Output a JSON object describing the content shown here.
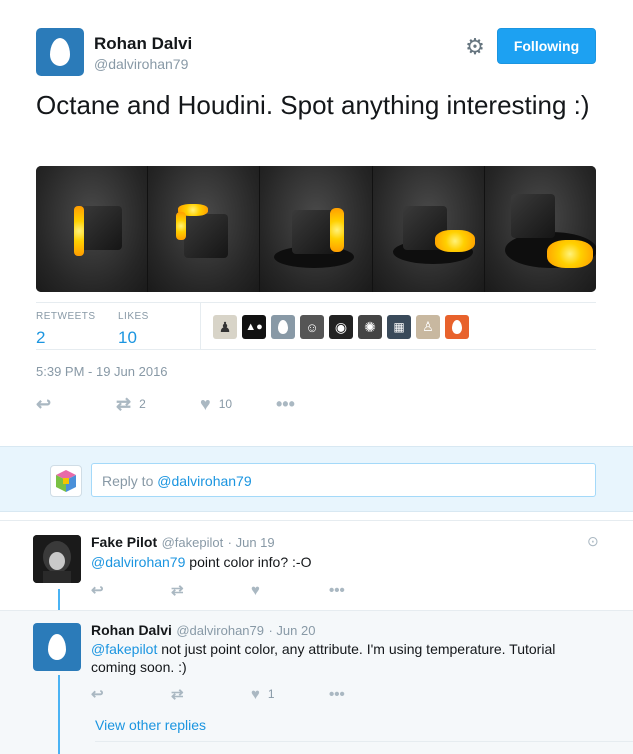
{
  "author": {
    "name": "Rohan Dalvi",
    "handle": "@dalvirohan79",
    "follow_label": "Following"
  },
  "tweet": {
    "text": "Octane and Houdini. Spot anything interesting :)",
    "retweets_label": "RETWEETS",
    "retweets": "2",
    "likes_label": "LIKES",
    "likes": "10",
    "timestamp": "5:39 PM - 19 Jun 2016",
    "action_retweet_count": "2",
    "action_like_count": "10"
  },
  "reply_box": {
    "prefix": "Reply to ",
    "mention": "@dalvirohan79"
  },
  "replies": [
    {
      "name": "Fake Pilot",
      "handle": "@fakepilot",
      "date": "· Jun 19",
      "mention": "@dalvirohan79",
      "text": " point color info? :-O",
      "like_count": ""
    },
    {
      "name": "Rohan Dalvi",
      "handle": "@dalvirohan79",
      "date": "· Jun 20",
      "mention": "@fakepilot",
      "text": " not just point color, any attribute. I'm using temperature. Tutorial coming soon. :)",
      "like_count": "1"
    }
  ],
  "view_other_replies": "View other replies",
  "colors": {
    "accent": "#1da1f2",
    "link": "#1b95e0",
    "muted": "#8899a6",
    "reply_bar_bg": "#e8f5fd"
  },
  "icons": [
    "gear-icon",
    "reply-icon",
    "retweet-icon",
    "heart-icon",
    "more-icon",
    "location-icon"
  ]
}
